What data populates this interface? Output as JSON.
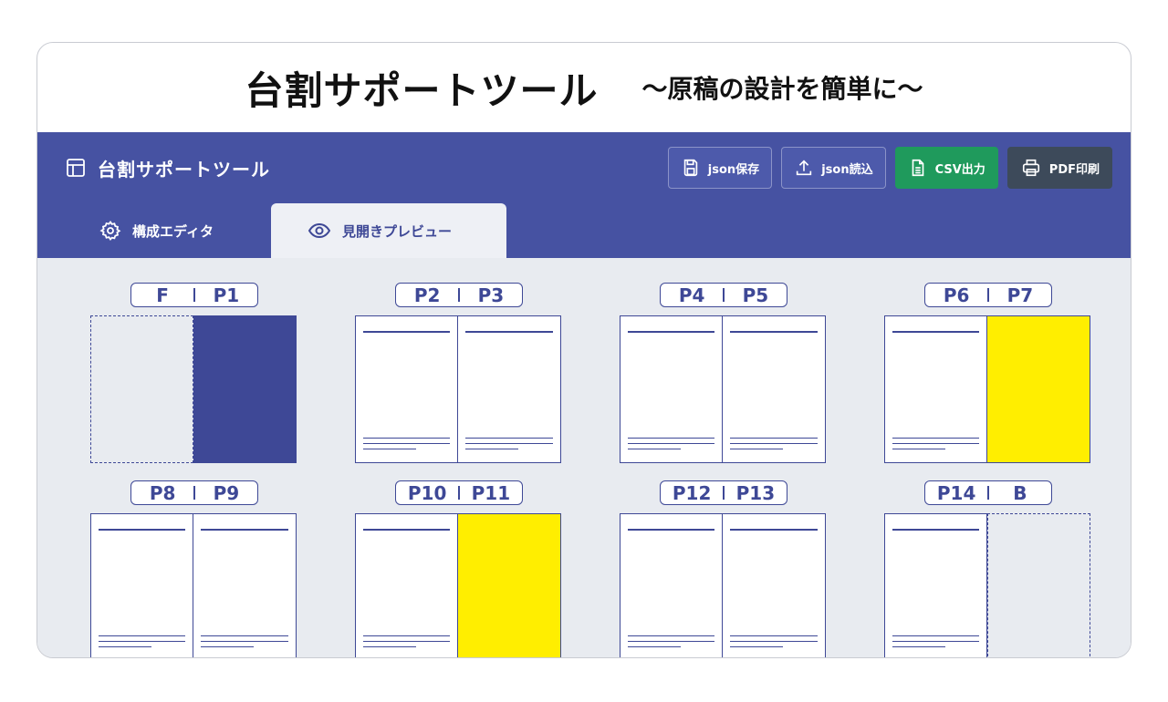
{
  "banner": {
    "title": "台割サポートツール",
    "subtitle": "〜原稿の設計を簡単に〜"
  },
  "app": {
    "brand": "台割サポートツール",
    "toolbar": {
      "json_save": "json保存",
      "json_load": "json読込",
      "csv_export": "CSV出力",
      "pdf_print": "PDF印刷"
    },
    "tabs": {
      "editor": "構成エディタ",
      "preview": "見開きプレビュー"
    }
  },
  "colors": {
    "header_bg": "#4652a2",
    "accent": "#3e4896",
    "csv_button": "#1f9a5c",
    "pdf_button": "#3d4a5a",
    "highlight_page": "#ffee00",
    "content_bg": "#e8ebf0"
  },
  "spreads": [
    {
      "left": "F",
      "right": "P1",
      "left_type": "blank",
      "right_type": "blue"
    },
    {
      "left": "P2",
      "right": "P3",
      "left_type": "text",
      "right_type": "text"
    },
    {
      "left": "P4",
      "right": "P5",
      "left_type": "text",
      "right_type": "text"
    },
    {
      "left": "P6",
      "right": "P7",
      "left_type": "text",
      "right_type": "yellow"
    },
    {
      "left": "P8",
      "right": "P9",
      "left_type": "text",
      "right_type": "text"
    },
    {
      "left": "P10",
      "right": "P11",
      "left_type": "text",
      "right_type": "yellow"
    },
    {
      "left": "P12",
      "right": "P13",
      "left_type": "text",
      "right_type": "text"
    },
    {
      "left": "P14",
      "right": "B",
      "left_type": "text",
      "right_type": "blank"
    }
  ]
}
